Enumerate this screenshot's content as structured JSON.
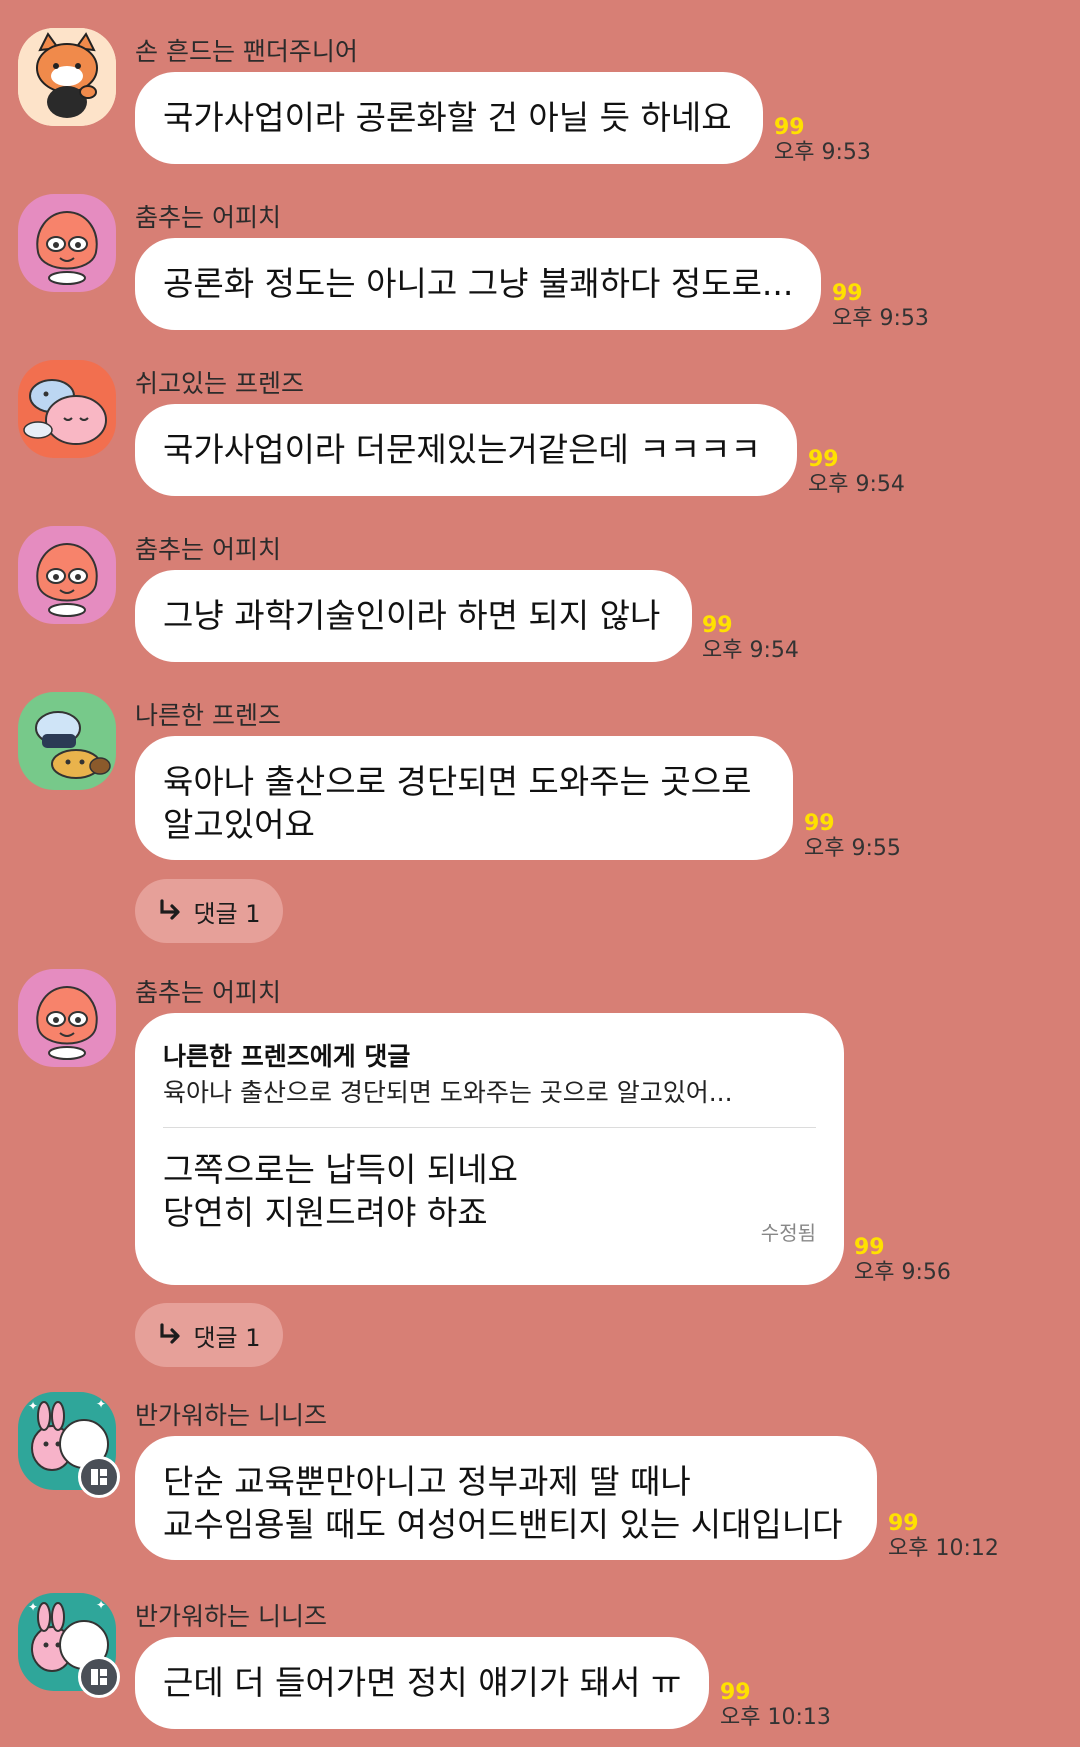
{
  "messages": [
    {
      "sender": "손 흔드는 팬더주니어",
      "lines": [
        "국가사업이라 공론화할 건 아닐 듯 하네요"
      ],
      "unread": "99",
      "time": "오후 9:53",
      "avatar": "panda-junior-avatar"
    },
    {
      "sender": "춤추는 어피치",
      "lines": [
        "공론화 정도는 아니고 그냥 불쾌하다 정도로..."
      ],
      "unread": "99",
      "time": "오후 9:53",
      "avatar": "apeach-avatar"
    },
    {
      "sender": "쉬고있는 프렌즈",
      "lines": [
        "국가사업이라 더문제있는거같은데 ㅋㅋㅋㅋ"
      ],
      "unread": "99",
      "time": "오후 9:54",
      "avatar": "resting-friends-avatar"
    },
    {
      "sender": "춤추는 어피치",
      "lines": [
        "그냥 과학기술인이라 하면 되지 않나"
      ],
      "unread": "99",
      "time": "오후 9:54",
      "avatar": "apeach-avatar"
    },
    {
      "sender": "나른한 프렌즈",
      "lines": [
        "육아나 출산으로 경단되면 도와주는 곳으로",
        "알고있어요"
      ],
      "unread": "99",
      "time": "오후 9:55",
      "avatar": "lazy-friends-avatar",
      "reply_label": "댓글 1"
    },
    {
      "sender": "춤추는 어피치",
      "quote_to": "나른한 프렌즈에게 댓글",
      "quote_text": "육아나 출산으로 경단되면 도와주는 곳으로 알고있어...",
      "lines": [
        "그쪽으로는 납득이 되네요",
        "당연히 지원드려야 하죠"
      ],
      "edited": "수정됨",
      "unread": "99",
      "time": "오후 9:56",
      "avatar": "apeach-avatar",
      "reply_label": "댓글 1"
    },
    {
      "sender": "반가워하는 니니즈",
      "lines": [
        "단순 교육뿐만아니고 정부과제 딸 때나",
        "교수임용될 때도 여성어드밴티지 있는 시대입니다"
      ],
      "unread": "99",
      "time": "오후 10:12",
      "avatar": "niniz-avatar"
    },
    {
      "sender": "반가워하는 니니즈",
      "lines": [
        "근데 더 들어가면 정치 얘기가 돼서 ㅠ"
      ],
      "unread": "99",
      "time": "오후 10:13",
      "avatar": "niniz-avatar"
    }
  ]
}
